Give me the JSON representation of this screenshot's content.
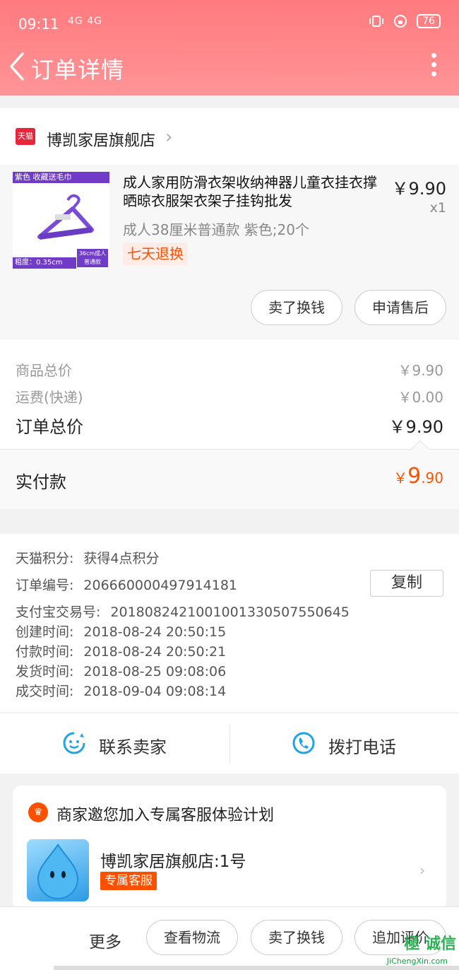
{
  "status_bar": {
    "time": "09:11",
    "signal": "4G 4G",
    "battery": "76"
  },
  "nav": {
    "title": "订单详情"
  },
  "shop": {
    "badge": "天猫",
    "name": "博凯家居旗舰店"
  },
  "product": {
    "image_top_text": "紫色 收藏送毛巾",
    "image_bottom_text": "粗度：0.35cm",
    "image_tag": "36cm成人普通款",
    "title": "成人家用防滑衣架收纳神器儿童衣挂衣撑晒晾衣服架衣架子挂钩批发",
    "price": "￥9.90",
    "qty": "x1",
    "sku": "成人38厘米普通款 紫色;20个",
    "return_policy": "七天退换",
    "btn_sell": "卖了换钱",
    "btn_after_sale": "申请售后"
  },
  "summary": {
    "goods_label": "商品总价",
    "goods_value": "￥9.90",
    "shipping_label": "运费(快递)",
    "shipping_value": "￥0.00",
    "total_label": "订单总价",
    "total_value": "￥9.90",
    "paid_label": "实付款",
    "paid_currency": "￥",
    "paid_int": "9",
    "paid_dec": ".90"
  },
  "info": {
    "points_label": "天猫积分:",
    "points_value": "获得4点积分",
    "order_label": "订单编号:",
    "order_value": "206660000497914181",
    "copy_label": "复制",
    "alipay_label": "支付宝交易号:",
    "alipay_value": "2018082421001001330507550645",
    "created_label": "创建时间:",
    "created_value": "2018-08-24 20:50:15",
    "paid_label": "付款时间:",
    "paid_value": "2018-08-24 20:50:21",
    "shipped_label": "发货时间:",
    "shipped_value": "2018-08-25 09:08:06",
    "completed_label": "成交时间:",
    "completed_value": "2018-09-04 09:08:14"
  },
  "contact": {
    "seller_label": "联系卖家",
    "phone_label": "拨打电话"
  },
  "plan": {
    "title": "商家邀您加入专属客服体验计划",
    "name": "博凯家居旗舰店:1号",
    "badge": "专属客服"
  },
  "bottom": {
    "more": "更多",
    "logistics": "查看物流",
    "sell": "卖了换钱",
    "review": "追加评价"
  },
  "watermark": {
    "text": "極 诚信",
    "sub": "JiChengXin.com"
  },
  "colors": {
    "header": "#ff8386",
    "accent": "#ff5000",
    "tmall": "#e6263b",
    "icon_blue": "#1fa4e8"
  }
}
